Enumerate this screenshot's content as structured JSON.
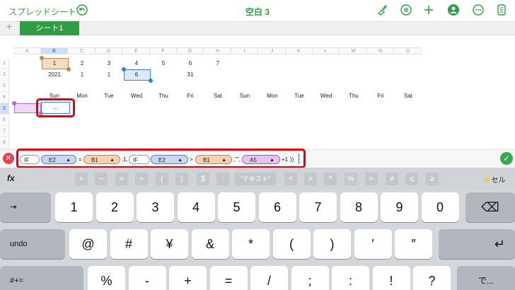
{
  "app": {
    "back_label": "スプレッドシート",
    "document_title": "空白 3"
  },
  "toolbar_icons": [
    "undo-icon",
    "brush-icon",
    "list-icon",
    "plus-icon",
    "collaborate-icon",
    "more-icon",
    "doc-icon"
  ],
  "sheet_tabs": {
    "active": "シート1"
  },
  "columns": [
    "A",
    "B",
    "C",
    "D",
    "E",
    "F",
    "G",
    "H",
    "I",
    "J",
    "K",
    "L",
    "M",
    "N",
    "O"
  ],
  "rows": [
    "1",
    "2",
    "3",
    "4",
    "5",
    "6",
    "7",
    "8",
    "9",
    "10"
  ],
  "cells": {
    "row1": [
      "1",
      "2",
      "3",
      "4",
      "5",
      "6",
      "7"
    ],
    "row2": [
      "2021",
      "1",
      "1",
      "6",
      "31"
    ],
    "row4": [
      "Sun",
      "Mon",
      "Tue",
      "Wed",
      "Thu",
      "Fri",
      "Sat",
      "Sun",
      "Mon",
      "Tue",
      "Wed",
      "Thu",
      "Fri",
      "Sat"
    ],
    "b5": "..."
  },
  "formula": {
    "if1": "IF",
    "e2": "E2",
    "eq": "=",
    "b1": "B1",
    "mid": ",1,",
    "if2": "IF",
    "e2b": "E2",
    "gt": ">",
    "b1b": "B1",
    "quote": ",\"\",",
    "a5": "A5",
    "plus": "+1",
    "close": "))"
  },
  "keyboard": {
    "fx_label": "fx",
    "ops": [
      "+",
      "−",
      "×",
      "÷",
      "(",
      ")",
      "$",
      ":",
      "\"テキスト\"",
      "<",
      ">",
      "^",
      "%",
      "=",
      "≠",
      "≤",
      "≥"
    ],
    "cell_label": "⚡セル",
    "row2": [
      "1",
      "2",
      "3",
      "4",
      "5",
      "6",
      "7",
      "8",
      "9",
      "0"
    ],
    "tab_label": "⇥",
    "delete_label": "⌫",
    "undo_label": "undo",
    "row3": [
      "@",
      "#",
      "¥",
      "&",
      "*",
      "(",
      ")",
      "′",
      "″"
    ],
    "return_label": "↵",
    "row4": [
      "%",
      "-",
      "+",
      "=",
      "/",
      ";",
      ":",
      "!",
      "?"
    ],
    "shift_label": "#+=",
    "bottom_label": "で..."
  }
}
